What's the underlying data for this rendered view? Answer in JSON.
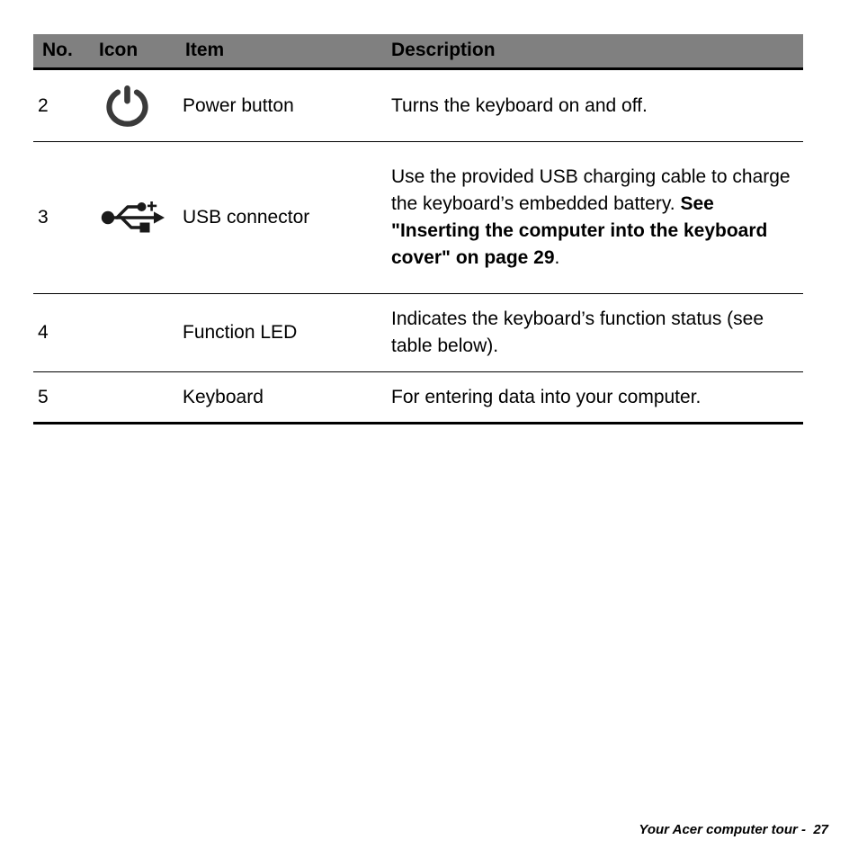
{
  "document": {
    "table": {
      "columns": [
        {
          "key": "no",
          "label": "No."
        },
        {
          "key": "icon",
          "label": "Icon"
        },
        {
          "key": "item",
          "label": "Item"
        },
        {
          "key": "desc",
          "label": "Description"
        }
      ],
      "header_background": "#808080",
      "rows": [
        {
          "no": "2",
          "icon": "power-button-icon",
          "item": "Power button",
          "description_plain": "Turns the keyboard on and off.",
          "description_html": "Turns the keyboard on and off."
        },
        {
          "no": "3",
          "icon": "usb-connector-icon",
          "item": "USB connector",
          "description_plain": "Use the provided USB charging cable to charge the keyboard’s embedded battery. See \"Inserting the computer into the keyboard cover\" on page 29.",
          "description_html": "Use the provided USB charging cable to charge the keyboard’s embedded battery. <b>See \"Inserting the computer into the keyboard cover\" on page 29</b>."
        },
        {
          "no": "4",
          "icon": "",
          "item": "Function LED",
          "description_plain": "Indicates the keyboard’s function status (see table below).",
          "description_html": "Indicates the keyboard’s function status (see table below)."
        },
        {
          "no": "5",
          "icon": "",
          "item": "Keyboard",
          "description_plain": "For entering data into your computer.",
          "description_html": "For entering data into your computer."
        }
      ]
    },
    "footer": {
      "text": "Your Acer computer tour -  27",
      "section": "Your Acer computer tour",
      "page_number": "27"
    },
    "colors": {
      "header_gray": "#808080",
      "text_black": "#000000",
      "icon_dark": "#3a3a3a",
      "page_background": "#ffffff"
    }
  }
}
